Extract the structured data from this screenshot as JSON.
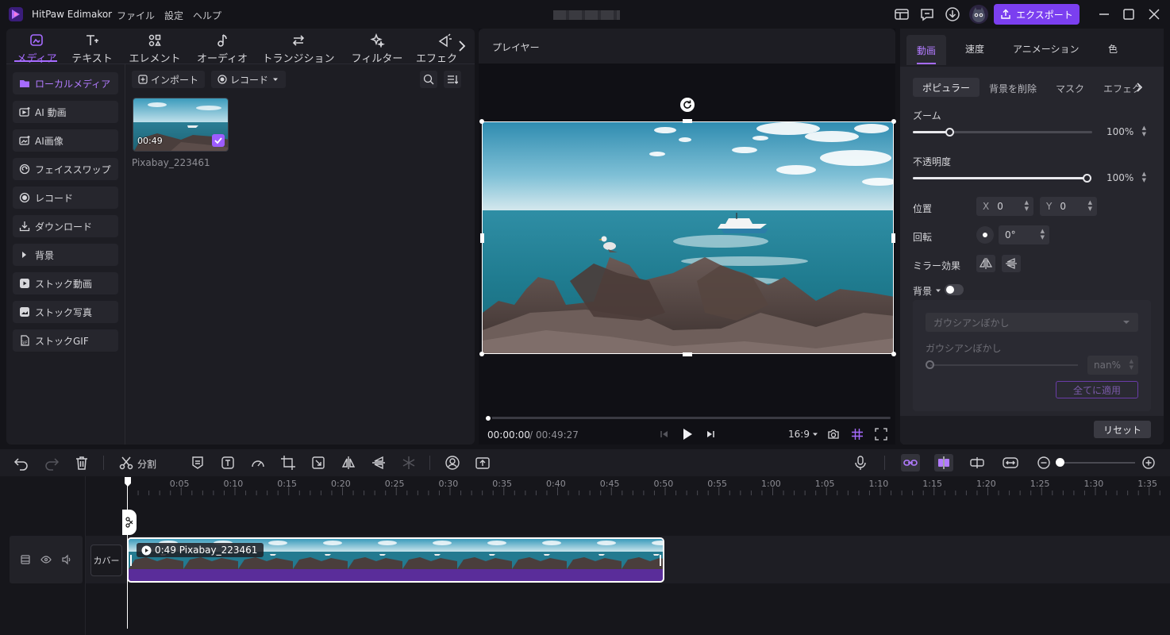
{
  "app": {
    "title": "HitPaw Edimakor",
    "menus": [
      "ファイル",
      "設定",
      "ヘルプ"
    ],
    "export_label": "エクスポート"
  },
  "media_tabs": [
    "メディア",
    "テキスト",
    "エレメント",
    "オーディオ",
    "トランジション",
    "フィルター",
    "エフェク"
  ],
  "sidebar": [
    "ローカルメディア",
    "AI 動画",
    "AI画像",
    "フェイススワップ",
    "レコード",
    "ダウンロード",
    "背景",
    "ストック動画",
    "ストック写真",
    "ストックGIF"
  ],
  "media_toolbar": {
    "import": "インポート",
    "record": "レコード"
  },
  "media_item": {
    "duration": "00:49",
    "name": "Pixabay_223461"
  },
  "player": {
    "title": "プレイヤー",
    "current": "00:00:00",
    "separator": "/",
    "total": "00:49:27",
    "ratio": "16:9"
  },
  "props": {
    "tabs": [
      "動画",
      "速度",
      "アニメーション",
      "色"
    ],
    "subtabs": [
      "ポピュラー",
      "背景を削除",
      "マスク",
      "エフェクト"
    ],
    "zoom_label": "ズーム",
    "zoom_value": "100%",
    "zoom_level": 0.2,
    "opacity_label": "不透明度",
    "opacity_value": "100%",
    "opacity_level": 1.0,
    "position_label": "位置",
    "x_label": "X",
    "x_value": "0",
    "y_label": "Y",
    "y_value": "0",
    "rotation_label": "回転",
    "rotation_value": "0°",
    "mirror_label": "ミラー効果",
    "bg_label": "背景",
    "blur_select": "ガウシアンぼかし",
    "blur_label": "ガウシアンぼかし",
    "blur_value": "nan%",
    "apply_all": "全てに適用",
    "reset": "リセット"
  },
  "timeline": {
    "split_label": "分割",
    "ticks": [
      "0:05",
      "0:10",
      "0:15",
      "0:20",
      "0:25",
      "0:30",
      "0:35",
      "0:40",
      "0:45",
      "0:50",
      "0:55",
      "1:00",
      "1:05",
      "1:10",
      "1:15",
      "1:20",
      "1:25",
      "1:30",
      "1:35"
    ],
    "cover_label": "カバー",
    "clip_label": "0:49 Pixabay_223461"
  },
  "colors": {
    "accent": "#9d5cff",
    "clip_purple": "#5a2d9a",
    "export_bg": "#7b3ff0"
  }
}
